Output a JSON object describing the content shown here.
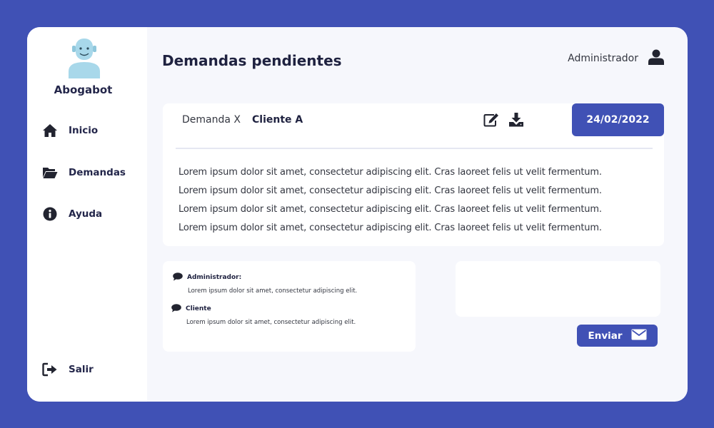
{
  "app": {
    "brand": "Abogabot"
  },
  "sidebar": {
    "items": [
      {
        "label": "Inicio",
        "icon": "home-icon"
      },
      {
        "label": "Demandas",
        "icon": "folder-open-icon"
      },
      {
        "label": "Ayuda",
        "icon": "info-icon"
      }
    ],
    "logout": {
      "label": "Salir",
      "icon": "sign-out-icon"
    }
  },
  "header": {
    "title": "Demandas pendientes",
    "user_name": "Administrador",
    "user_icon": "user-icon"
  },
  "demand": {
    "name": "Demanda X",
    "client": "Cliente A",
    "date": "24/02/2022",
    "edit_icon": "edit-icon",
    "download_icon": "download-icon",
    "lines": [
      "Lorem ipsum dolor sit amet, consectetur adipiscing elit. Cras laoreet felis ut velit fermentum.",
      "Lorem ipsum dolor sit amet, consectetur adipiscing elit. Cras laoreet felis ut velit fermentum.",
      "Lorem ipsum dolor sit amet, consectetur adipiscing elit. Cras laoreet felis ut velit fermentum.",
      "Lorem ipsum dolor sit amet, consectetur adipiscing elit. Cras laoreet felis ut velit fermentum."
    ]
  },
  "comments": [
    {
      "author": "Administrador:",
      "text": "Lorem ipsum dolor sit amet, consectetur adipiscing elit.",
      "icon": "comment-icon"
    },
    {
      "author": "Cliente",
      "text": "Lorem ipsum dolor sit amet, consectetur adipiscing elit.",
      "icon": "comment-icon"
    }
  ],
  "reply": {
    "value": "",
    "placeholder": "",
    "send_label": "Enviar",
    "send_icon": "envelope-icon"
  },
  "colors": {
    "accent": "#4051b5",
    "background": "#f6f7fc",
    "sidebar": "#ffffff",
    "text_dark": "#1f2240",
    "avatar": "#a8d8ea"
  }
}
